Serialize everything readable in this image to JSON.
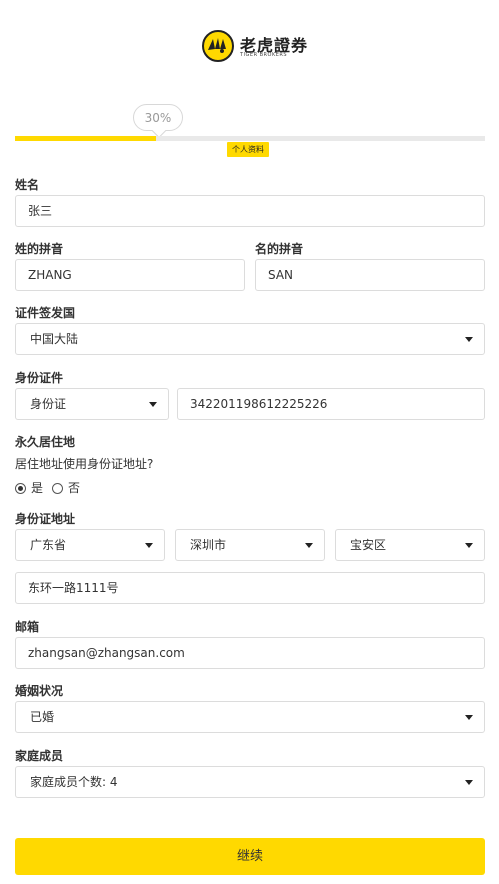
{
  "brand": {
    "name_cn": "老虎證券",
    "name_en": "TIGER BROKERS"
  },
  "progress": {
    "percent_label": "30%",
    "percent": 30,
    "step_tag": "个人资料"
  },
  "form": {
    "name": {
      "label": "姓名",
      "value": "张三"
    },
    "surname_pinyin": {
      "label": "姓的拼音",
      "value": "ZHANG"
    },
    "given_pinyin": {
      "label": "名的拼音",
      "value": "SAN"
    },
    "issuing_country": {
      "label": "证件签发国",
      "value": "中国大陆"
    },
    "id_document": {
      "label": "身份证件",
      "type": "身份证",
      "number": "342201198612225226"
    },
    "permanent_residence": {
      "label": "永久居住地",
      "question": "居住地址使用身份证地址?",
      "options": [
        {
          "label": "是",
          "checked": true
        },
        {
          "label": "否",
          "checked": false
        }
      ]
    },
    "id_address": {
      "label": "身份证地址",
      "province": "广东省",
      "city": "深圳市",
      "district": "宝安区",
      "street": "东环一路1111号"
    },
    "email": {
      "label": "邮箱",
      "value": "zhangsan@zhangsan.com"
    },
    "marital_status": {
      "label": "婚姻状况",
      "value": "已婚"
    },
    "family": {
      "label": "家庭成员",
      "value": "家庭成员个数: 4"
    }
  },
  "actions": {
    "continue": "继续"
  },
  "colors": {
    "accent": "#ffd900",
    "border": "#dcdcdc",
    "text": "#333333"
  }
}
